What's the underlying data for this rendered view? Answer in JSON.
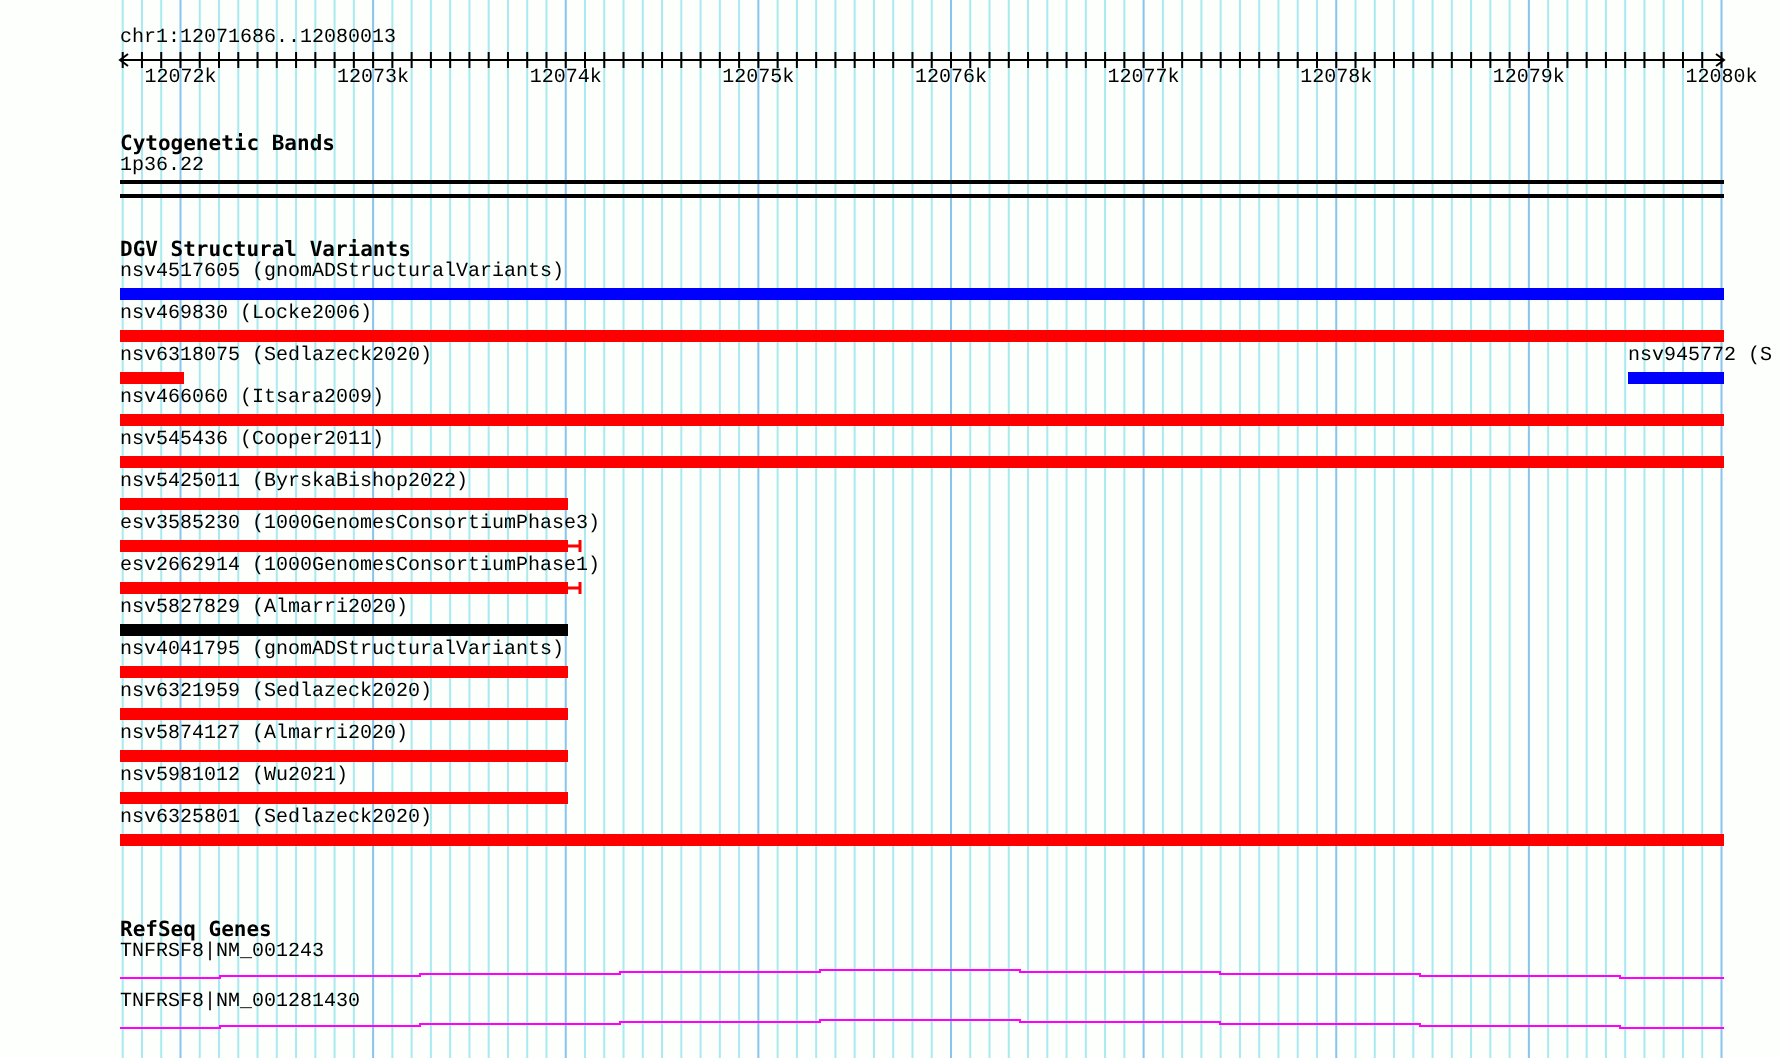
{
  "ruler": {
    "location": "chr1:12071686..12080013",
    "ticks": [
      "12072k",
      "12073k",
      "12074k",
      "12075k",
      "12076k",
      "12077k",
      "12078k",
      "12079k",
      "12080k"
    ]
  },
  "cytobands": {
    "title": "Cytogenetic Bands",
    "band": "1p36.22"
  },
  "variants": {
    "title": "DGV Structural Variants",
    "rows": [
      {
        "features": [
          {
            "label": "nsv4517605 (gnomADStructuralVariants)",
            "color": "#0000ff",
            "kind": "full"
          }
        ]
      },
      {
        "features": [
          {
            "label": "nsv469830 (Locke2006)",
            "color": "#ff0000",
            "kind": "full"
          }
        ]
      },
      {
        "features": [
          {
            "label": "nsv6318075 (Sedlazeck2020)",
            "color": "#ff0000",
            "kind": "stub"
          },
          {
            "label": "nsv945772 (S",
            "color": "#0000ff",
            "kind": "tail"
          }
        ]
      },
      {
        "features": [
          {
            "label": "nsv466060 (Itsara2009)",
            "color": "#ff0000",
            "kind": "full"
          }
        ]
      },
      {
        "features": [
          {
            "label": "nsv545436 (Cooper2011)",
            "color": "#ff0000",
            "kind": "full"
          }
        ]
      },
      {
        "features": [
          {
            "label": "nsv5425011 (ByrskaBishop2022)",
            "color": "#ff0000",
            "kind": "partial"
          }
        ]
      },
      {
        "features": [
          {
            "label": "esv3585230 (1000GenomesConsortiumPhase3)",
            "color": "#ff0000",
            "kind": "whisker"
          }
        ]
      },
      {
        "features": [
          {
            "label": "esv2662914 (1000GenomesConsortiumPhase1)",
            "color": "#ff0000",
            "kind": "whisker"
          }
        ]
      },
      {
        "features": [
          {
            "label": "nsv5827829 (Almarri2020)",
            "color": "#000000",
            "kind": "partial"
          }
        ]
      },
      {
        "features": [
          {
            "label": "nsv4041795 (gnomADStructuralVariants)",
            "color": "#ff0000",
            "kind": "partial"
          }
        ]
      },
      {
        "features": [
          {
            "label": "nsv6321959 (Sedlazeck2020)",
            "color": "#ff0000",
            "kind": "partial"
          }
        ]
      },
      {
        "features": [
          {
            "label": "nsv5874127 (Almarri2020)",
            "color": "#ff0000",
            "kind": "partial"
          }
        ]
      },
      {
        "features": [
          {
            "label": "nsv5981012 (Wu2021)",
            "color": "#ff0000",
            "kind": "partial"
          }
        ]
      },
      {
        "features": [
          {
            "label": "nsv6325801 (Sedlazeck2020)",
            "color": "#ff0000",
            "kind": "full"
          }
        ]
      }
    ]
  },
  "genes": {
    "title": "RefSeq Genes",
    "transcripts": [
      {
        "label": "TNFRSF8|NM_001243"
      },
      {
        "label": "TNFRSF8|NM_001281430"
      }
    ]
  }
}
